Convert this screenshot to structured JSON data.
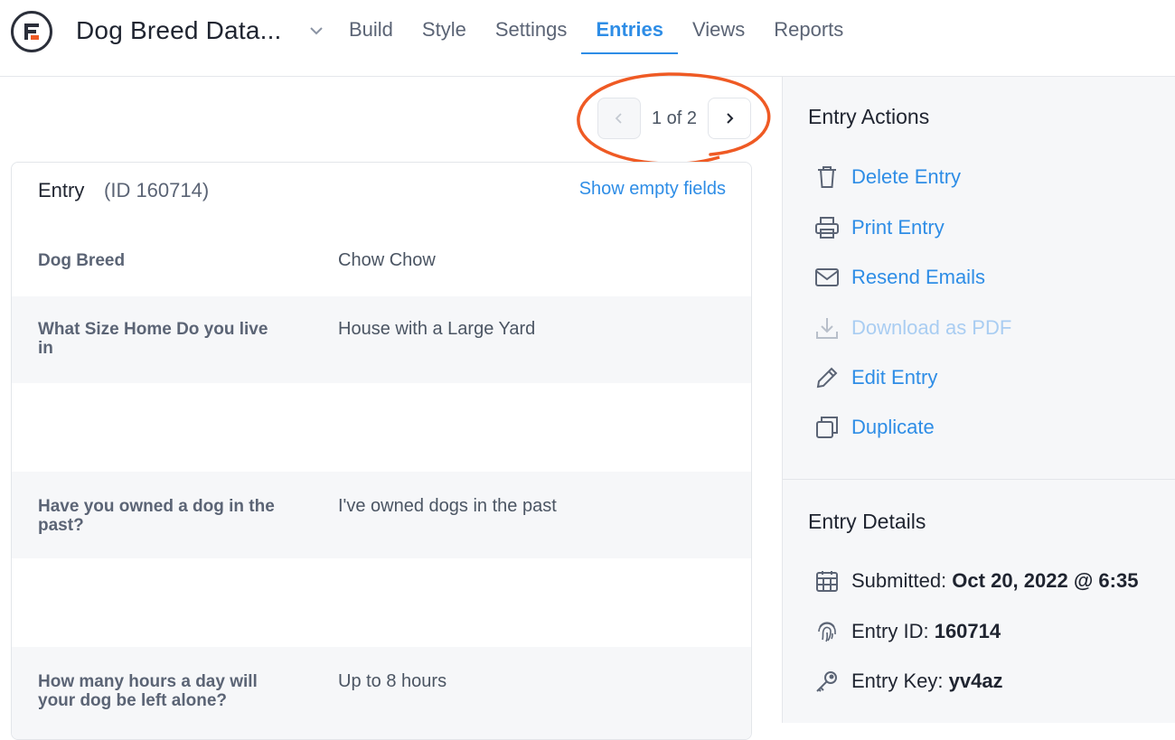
{
  "header": {
    "form_title": "Dog Breed Data...",
    "nav": [
      {
        "label": "Build"
      },
      {
        "label": "Style"
      },
      {
        "label": "Settings"
      },
      {
        "label": "Entries",
        "active": true
      },
      {
        "label": "Views"
      },
      {
        "label": "Reports"
      }
    ]
  },
  "pager": {
    "text": "1 of 2"
  },
  "entry": {
    "label": "Entry",
    "id_text": "(ID 160714)",
    "show_empty_label": "Show empty fields",
    "fields": [
      {
        "question": "Dog Breed",
        "answer": "Chow Chow"
      },
      {
        "question": "What Size Home Do you live in",
        "answer": "House with a Large Yard"
      },
      {
        "question": "Have you owned a dog in the past?",
        "answer": "I've owned dogs in the past"
      },
      {
        "question": "How many hours a day will your dog be left alone?",
        "answer": "Up to 8 hours"
      }
    ]
  },
  "sidebar": {
    "actions_title": "Entry Actions",
    "actions": [
      {
        "label": "Delete Entry",
        "icon": "trash-icon"
      },
      {
        "label": "Print Entry",
        "icon": "printer-icon"
      },
      {
        "label": "Resend Emails",
        "icon": "envelope-icon"
      },
      {
        "label": "Download as PDF",
        "icon": "download-icon",
        "disabled": true
      },
      {
        "label": "Edit Entry",
        "icon": "pencil-icon"
      },
      {
        "label": "Duplicate",
        "icon": "duplicate-icon"
      }
    ],
    "details_title": "Entry Details",
    "details": [
      {
        "label": "Submitted:",
        "value": "Oct 20, 2022 @ 6:35",
        "icon": "calendar-icon"
      },
      {
        "label": "Entry ID:",
        "value": "160714",
        "icon": "fingerprint-icon"
      },
      {
        "label": "Entry Key:",
        "value": "yv4az",
        "icon": "key-icon"
      }
    ]
  },
  "colors": {
    "accent": "#2e8de6",
    "highlight_circle": "#ef5a24",
    "logo_accent": "#ef5a24"
  }
}
